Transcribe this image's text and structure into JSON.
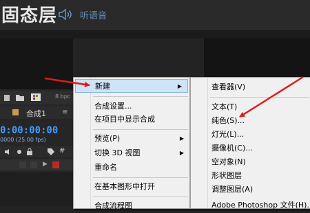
{
  "banner": {
    "title": "固态层",
    "listen_label": "听语音"
  },
  "panel": {
    "bpc_label": "8 bpc",
    "comp_tab": "合成1",
    "timecode": "0:00:00:00",
    "fps": "0000 (25.00 fps)"
  },
  "context_menu": {
    "items": [
      {
        "label": "新建",
        "submenu": true,
        "highlighted": true
      },
      {
        "label": "合成设置...",
        "submenu": false
      },
      {
        "label": "在项目中显示合成",
        "submenu": false
      },
      {
        "label": "预览(P)",
        "submenu": true
      },
      {
        "label": "切换 3D 视图",
        "submenu": true
      },
      {
        "label": "重命名",
        "submenu": false
      },
      {
        "label": "在基本图形中打开",
        "submenu": false
      },
      {
        "label": "合成流程图",
        "submenu": false
      }
    ]
  },
  "submenu": {
    "items": [
      {
        "label": "查看器(V)"
      },
      {
        "label": "文本(T)"
      },
      {
        "label": "纯色(S)..."
      },
      {
        "label": "灯光(L)..."
      },
      {
        "label": "摄像机(C)..."
      },
      {
        "label": "空对象(N)"
      },
      {
        "label": "形状图层"
      },
      {
        "label": "调整图层(A)"
      },
      {
        "label": "Adobe Photoshop 文件(H)..."
      }
    ]
  },
  "colors": {
    "arrow": "#e0191b",
    "timecode": "#3b9bff",
    "highlight": "#cfe3f7",
    "accent_swatch": "#b82a2a"
  },
  "icons": [
    "speaker-icon",
    "folder-icon",
    "composition-icon",
    "tag-icon",
    "lock-icon",
    "eye-icon"
  ]
}
